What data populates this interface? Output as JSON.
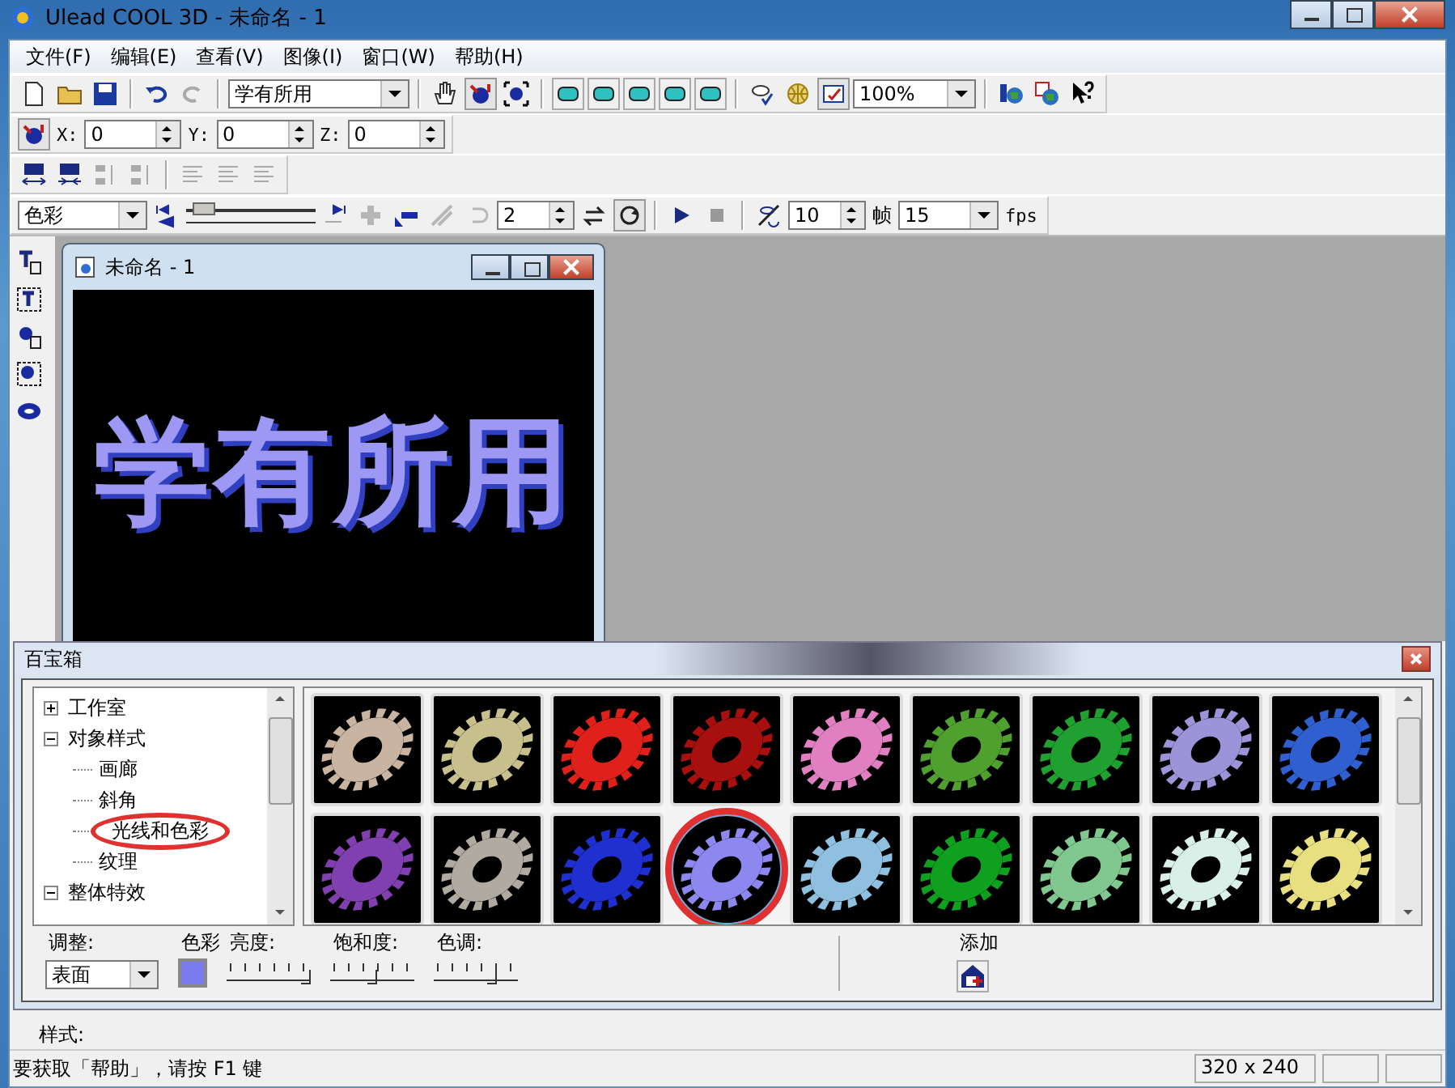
{
  "window": {
    "title": "Ulead COOL 3D - 未命名 - 1"
  },
  "menu": [
    "文件(F)",
    "编辑(E)",
    "查看(V)",
    "图像(I)",
    "窗口(W)",
    "帮助(H)"
  ],
  "toolbar": {
    "text_combo": "学有所用",
    "zoom_combo": "100%"
  },
  "position": [
    {
      "label": "X:",
      "value": "0"
    },
    {
      "label": "Y:",
      "value": "0"
    },
    {
      "label": "Z:",
      "value": "0"
    }
  ],
  "animation": {
    "property_combo": "色彩",
    "timeline": {
      "level": 0.05
    },
    "frame_spin": "2",
    "frames_spin": "10",
    "frames_label": "帧",
    "fps_combo": "15",
    "fps_label": "fps"
  },
  "document": {
    "title": "未命名 - 1",
    "canvas_text": "学有所用"
  },
  "easy_palette": {
    "title": "百宝箱",
    "tree": [
      {
        "label": "工作室",
        "expanded": false,
        "annotated": false
      },
      {
        "label": "对象样式",
        "expanded": true,
        "annotated": false,
        "children": [
          {
            "label": "画廊",
            "annotated": false
          },
          {
            "label": "斜角",
            "annotated": false
          },
          {
            "label": "光线和色彩",
            "annotated": true
          },
          {
            "label": "纹理",
            "annotated": false
          }
        ]
      },
      {
        "label": "整体特效",
        "expanded": true,
        "annotated": false
      }
    ],
    "gallery": [
      {
        "color": "#c8b4a0",
        "selected": false,
        "annotated": false
      },
      {
        "color": "#c8c08c",
        "selected": false,
        "annotated": false
      },
      {
        "color": "#e0201a",
        "selected": false,
        "annotated": false
      },
      {
        "color": "#a81010",
        "selected": false,
        "annotated": false
      },
      {
        "color": "#e080c0",
        "selected": false,
        "annotated": false
      },
      {
        "color": "#50a030",
        "selected": false,
        "annotated": false
      },
      {
        "color": "#20a030",
        "selected": false,
        "annotated": false
      },
      {
        "color": "#9c94d8",
        "selected": false,
        "annotated": false
      },
      {
        "color": "#3060d0",
        "selected": false,
        "annotated": false
      },
      {
        "color": "#8040b0",
        "selected": false,
        "annotated": false
      },
      {
        "color": "#b0aaa0",
        "selected": false,
        "annotated": false
      },
      {
        "color": "#2030d0",
        "selected": false,
        "annotated": false
      },
      {
        "color": "#8c88f0",
        "selected": true,
        "annotated": true
      },
      {
        "color": "#90c0e0",
        "selected": false,
        "annotated": false
      },
      {
        "color": "#10a020",
        "selected": false,
        "annotated": false
      },
      {
        "color": "#80c890",
        "selected": false,
        "annotated": false
      },
      {
        "color": "#d8f0e8",
        "selected": false,
        "annotated": false
      },
      {
        "color": "#e8e080",
        "selected": false,
        "annotated": false
      }
    ],
    "adjust_label": "调整:",
    "adjust_combo": "表面",
    "color_label": "色彩",
    "color": "#7b7bf0",
    "sliders": [
      {
        "label": "亮度:",
        "level": 0.95
      },
      {
        "label": "饱和度:",
        "level": 0.5
      },
      {
        "label": "色调:",
        "level": 0.7
      }
    ],
    "add_label": "添加"
  },
  "style_label": "样式:",
  "status_bar": {
    "message": "要获取「帮助」，请按 F1 键",
    "size": "320 x 240"
  }
}
